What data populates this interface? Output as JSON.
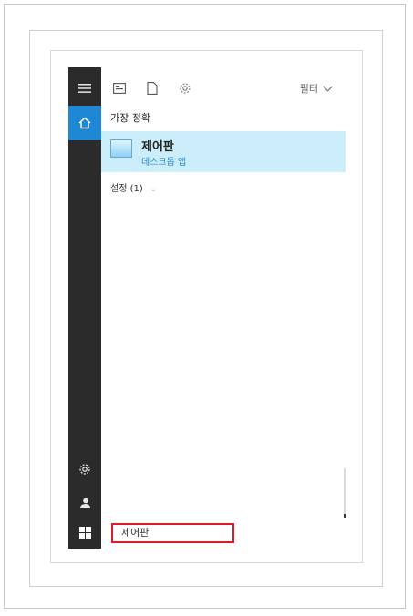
{
  "toolbar": {
    "filter_label": "필터",
    "icons": [
      "app-list-icon",
      "document-icon",
      "gear-icon"
    ]
  },
  "results": {
    "best_match_header": "가장 정확",
    "best_match": {
      "name": "제어판",
      "type": "데스크톱 앱",
      "icon": "control-panel-icon"
    },
    "settings_header": "설정 (1)",
    "settings_chevron": "⌄"
  },
  "rail": {
    "icons": [
      "hamburger-menu-icon",
      "home-icon",
      "gear-icon",
      "user-icon",
      "windows-start-icon"
    ]
  },
  "search": {
    "value": "제어판"
  },
  "colors": {
    "accent": "#1e88d7",
    "highlight": "#cbeefa",
    "rail": "#2b2b2b",
    "callout": "#e01b24"
  }
}
